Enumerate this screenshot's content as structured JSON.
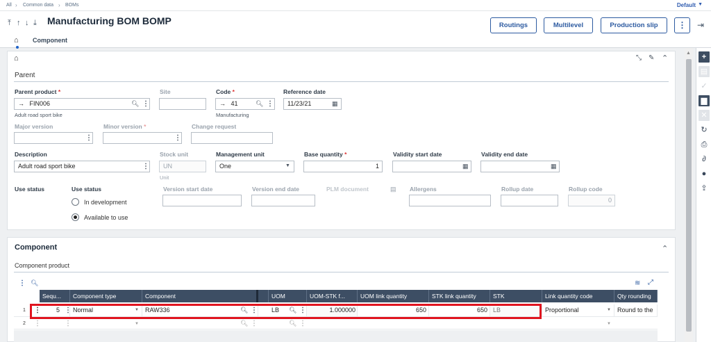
{
  "breadcrumb": {
    "root": "All",
    "level1": "Common data",
    "level2": "BOMs"
  },
  "environment": "Default",
  "page_title": "Manufacturing BOM BOMP",
  "header_buttons": {
    "routings": "Routings",
    "multilevel": "Multilevel",
    "production_slip": "Production slip"
  },
  "tabs": {
    "component": "Component"
  },
  "parent_section": {
    "title": "Parent",
    "parent_product": {
      "label": "Parent product",
      "value": "FIN006",
      "description": "Adult road sport bike"
    },
    "site": {
      "label": "Site",
      "value": ""
    },
    "code": {
      "label": "Code",
      "value": "41",
      "description": "Manufacturing"
    },
    "reference_date": {
      "label": "Reference date",
      "value": "11/23/21"
    },
    "major_version": {
      "label": "Major version",
      "value": ""
    },
    "minor_version": {
      "label": "Minor version",
      "value": ""
    },
    "change_request": {
      "label": "Change request",
      "value": ""
    },
    "description": {
      "label": "Description",
      "value": "Adult road sport bike"
    },
    "stock_unit": {
      "label": "Stock unit",
      "value": "UN",
      "description": "Unit"
    },
    "management_unit": {
      "label": "Management unit",
      "value": "One"
    },
    "base_quantity": {
      "label": "Base quantity",
      "value": "1"
    },
    "validity_start_date": {
      "label": "Validity start date",
      "value": ""
    },
    "validity_end_date": {
      "label": "Validity end date",
      "value": ""
    },
    "use_status_left": "Use status",
    "use_status": {
      "label": "Use status",
      "options": [
        "In development",
        "Available to use"
      ],
      "selected": "Available to use"
    },
    "version_start_date": {
      "label": "Version start date",
      "value": ""
    },
    "version_end_date": {
      "label": "Version end date",
      "value": ""
    },
    "plm_document": {
      "label": "PLM document"
    },
    "allergens": {
      "label": "Allergens",
      "value": ""
    },
    "rollup_date": {
      "label": "Rollup date",
      "value": ""
    },
    "rollup_code": {
      "label": "Rollup code",
      "value": "0"
    }
  },
  "component_section": {
    "title": "Component",
    "subtitle": "Component product",
    "columns": [
      "Sequ...",
      "Component type",
      "Component",
      "UOM",
      "UOM-STK f...",
      "UOM link quantity",
      "STK link quantity",
      "STK",
      "Link quantity code",
      "Qty rounding"
    ],
    "rows": [
      {
        "num": "1",
        "sequence": "5",
        "component_type": "Normal",
        "component": "RAW336",
        "uom": "LB",
        "uom_stk_factor": "1.000000",
        "uom_link_qty": "650",
        "stk_link_qty": "650",
        "stk": "LB",
        "link_qty_code": "Proportional",
        "qty_rounding": "Round to the"
      },
      {
        "num": "2",
        "sequence": "",
        "component_type": "",
        "component": "",
        "uom": "",
        "uom_stk_factor": "",
        "uom_link_qty": "",
        "stk_link_qty": "",
        "stk": "",
        "link_qty_code": "",
        "qty_rounding": ""
      }
    ]
  },
  "icons": [
    "home-icon",
    "search-icon",
    "calendar-icon",
    "arrow-right-icon",
    "more-vertical-icon",
    "chevron-up-icon",
    "pin-icon",
    "edit-icon",
    "plus-icon",
    "save-icon",
    "check-icon",
    "trash-icon",
    "close-icon",
    "refresh-icon",
    "print-icon",
    "paperclip-icon",
    "comment-icon",
    "share-icon",
    "logout-icon",
    "layers-icon",
    "expand-icon"
  ],
  "colors": {
    "accent": "#2c5aa0",
    "grid_header": "#3d4e64",
    "highlight": "#e0141f"
  }
}
